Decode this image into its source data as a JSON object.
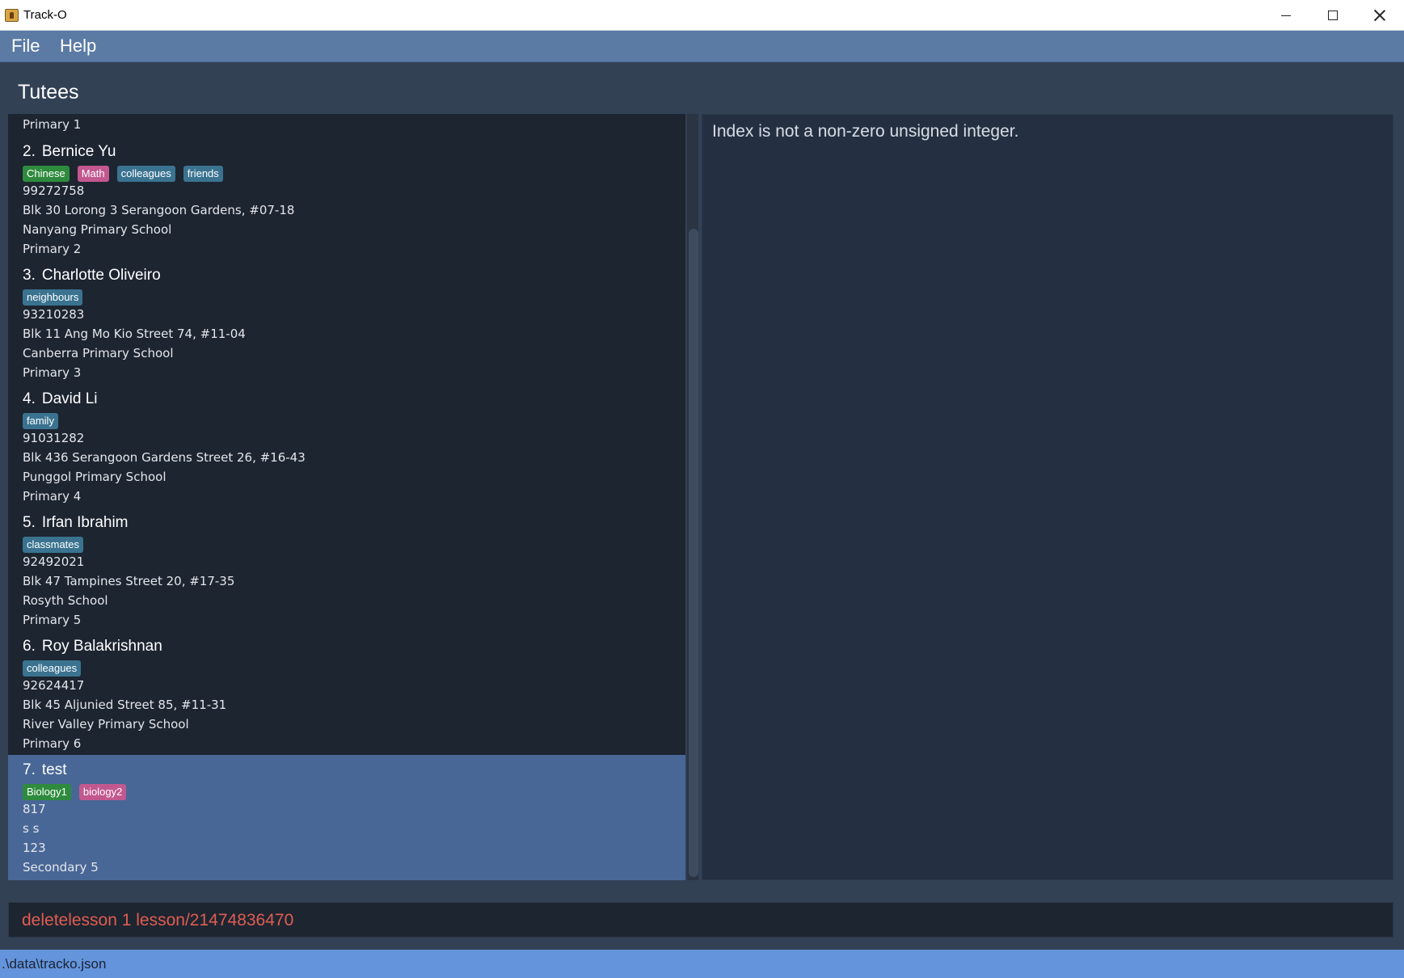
{
  "window": {
    "title": "Track-O"
  },
  "menu": {
    "file": "File",
    "help": "Help"
  },
  "section_title": "Tutees",
  "list": {
    "partial_top_line": "Primary 1",
    "tutees": [
      {
        "index": "2.",
        "name": "Bernice Yu",
        "tags": [
          {
            "label": "Chinese",
            "color": "#2e8b3d"
          },
          {
            "label": "Math",
            "color": "#c2588f"
          },
          {
            "label": "colleagues",
            "color": "#3a7390"
          },
          {
            "label": "friends",
            "color": "#3a7390"
          }
        ],
        "phone": "99272758",
        "address": "Blk 30 Lorong 3 Serangoon Gardens, #07-18",
        "school": "Nanyang Primary School",
        "level": "Primary 2"
      },
      {
        "index": "3.",
        "name": "Charlotte Oliveiro",
        "tags": [
          {
            "label": "neighbours",
            "color": "#3a7390"
          }
        ],
        "phone": "93210283",
        "address": "Blk 11 Ang Mo Kio Street 74, #11-04",
        "school": "Canberra Primary School",
        "level": "Primary 3"
      },
      {
        "index": "4.",
        "name": "David Li",
        "tags": [
          {
            "label": "family",
            "color": "#3a7390"
          }
        ],
        "phone": "91031282",
        "address": "Blk 436 Serangoon Gardens Street 26, #16-43",
        "school": "Punggol Primary School",
        "level": "Primary 4"
      },
      {
        "index": "5.",
        "name": "Irfan Ibrahim",
        "tags": [
          {
            "label": "classmates",
            "color": "#3a7390"
          }
        ],
        "phone": "92492021",
        "address": "Blk 47 Tampines Street 20, #17-35",
        "school": "Rosyth School",
        "level": "Primary 5"
      },
      {
        "index": "6.",
        "name": "Roy Balakrishnan",
        "tags": [
          {
            "label": "colleagues",
            "color": "#3a7390"
          }
        ],
        "phone": "92624417",
        "address": "Blk 45 Aljunied Street 85, #11-31",
        "school": "River Valley Primary School",
        "level": "Primary 6"
      },
      {
        "index": "7.",
        "name": "test",
        "selected": true,
        "tags": [
          {
            "label": "Biology1",
            "color": "#2e8b3d"
          },
          {
            "label": "biology2",
            "color": "#c2588f"
          }
        ],
        "phone": "817",
        "address": "s s",
        "school": "123",
        "level": "Secondary 5"
      }
    ]
  },
  "result": {
    "message": "Index is not a non-zero unsigned integer."
  },
  "command": {
    "value": "deletelesson 1 lesson/21474836470"
  },
  "status": {
    "path": ".\\data\\tracko.json"
  }
}
